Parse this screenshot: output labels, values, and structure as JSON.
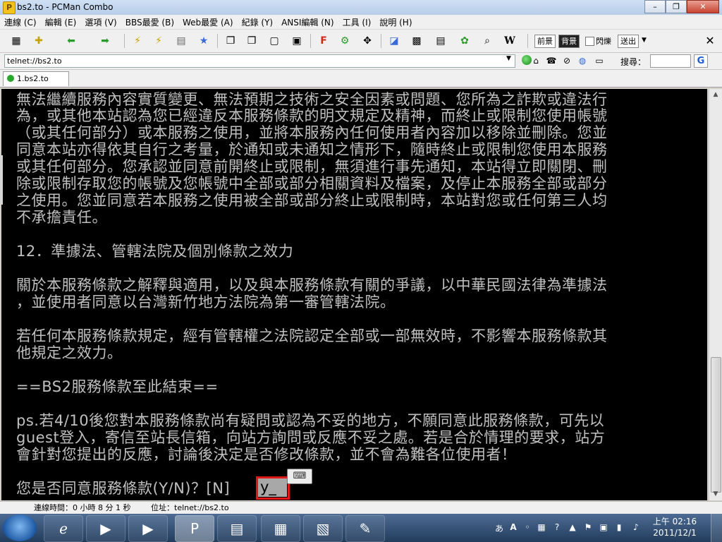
{
  "window": {
    "title": "bs2.to - PCMan Combo"
  },
  "menu": [
    "連線 (C)",
    "編輯 (E)",
    "選項 (V)",
    "BBS最愛 (B)",
    "Web最愛 (A)",
    "紀錄 (Y)",
    "ANSI編輯 (N)",
    "工具 (I)",
    "說明 (H)"
  ],
  "toolbar": {
    "prev_label": "前景",
    "bg_label": "背景",
    "blink_label": "閃爍",
    "send_label": "送出"
  },
  "address": {
    "value": "telnet://bs2.to"
  },
  "search": {
    "label": "搜尋：",
    "placeholder": ""
  },
  "tab": {
    "label": "1.bs2.to"
  },
  "terminal": {
    "lines": [
      "無法繼續服務內容實質變更、無法預期之技術之安全因素或問題、您所為之詐欺或違法行",
      "為，或其他本站認為您已經違反本服務條款的明文規定及精神，而終止或限制您使用帳號",
      "（或其任何部分）或本服務之使用，並將本服務內任何使用者內容加以移除並刪除。您並",
      "同意本站亦得依其自行之考量，於通知或未通知之情形下，隨時終止或限制您使用本服務",
      "或其任何部分。您承認並同意前開終止或限制，無須進行事先通知，本站得立即關閉、刪",
      "除或限制存取您的帳號及您帳號中全部或部分相關資料及檔案，及停止本服務全部或部分",
      "之使用。您並同意若本服務之使用被全部或部分終止或限制時，本站對您或任何第三人均",
      "不承擔責任。",
      "",
      "12．準據法、管轄法院及個別條款之效力",
      "",
      "關於本服務條款之解釋與適用，以及與本服務條款有關的爭議，以中華民國法律為準據法",
      "，並使用者同意以台灣新竹地方法院為第一審管轄法院。",
      "",
      "若任何本服務條款規定，經有管轄權之法院認定全部或一部無效時，不影響本服務條款其",
      "他規定之效力。",
      "",
      "==BS2服務條款至此結束==",
      "",
      "ps.若4/10後您對本服務條款尚有疑問或認為不妥的地方，不願同意此服務條款，可先以",
      "guest登入，寄信至站長信箱，向站方詢問或反應不妥之處。若是合於情理的要求，站方",
      "會針對您提出的反應，討論後決定是否修改條款，並不會為難各位使用者！",
      "",
      "您是否同意服務條款(Y/N)？[N]"
    ],
    "input_value": "y_"
  },
  "status": {
    "connect_label": "連線時間：0 小時 8 分 1 秒",
    "addr_label": "位址：telnet://bs2.to"
  },
  "taskbar": {
    "clock_time": "上午 02:16",
    "clock_date": "2011/12/1",
    "ime_label": "A"
  },
  "colors": {
    "terminal_bg": "#000000",
    "terminal_fg": "#c0c0c0",
    "highlight": "#e01818"
  }
}
